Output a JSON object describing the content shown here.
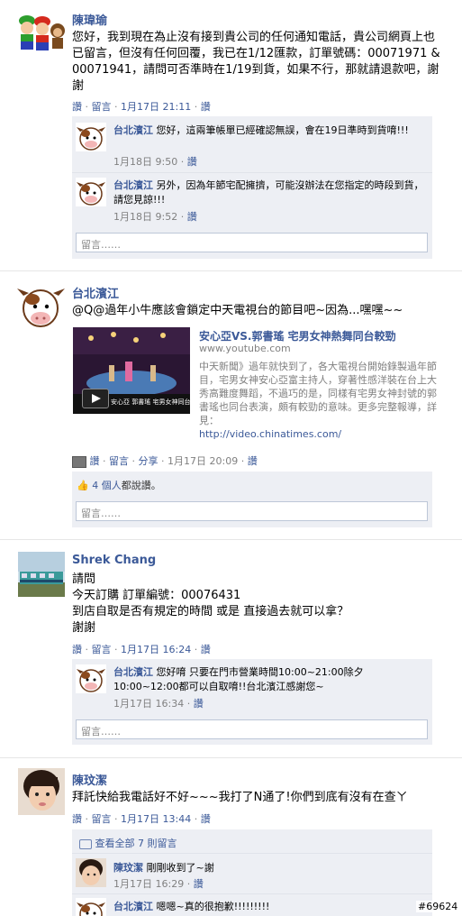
{
  "posts": [
    {
      "name": "陳瑋瑜",
      "text": "您好，我到現在為止沒有接到貴公司的任何通知電話，貴公司網頁上也已留言，但沒有任何回覆，我已在1/12匯款，訂單號碼：00071971 & 00071941，請問可否準時在1/19到貨，如果不行，那就請退款吧，謝謝",
      "like": "讚",
      "comment": "留言",
      "time": "1月17日 21:11",
      "replies": [
        {
          "name": "台北濱江",
          "text": "您好，這兩筆帳單已經確認無誤，會在19日準時到貨唷!!!",
          "time": "1月18日 9:50",
          "like": "讚"
        },
        {
          "name": "台北濱江",
          "text": "另外，因為年節宅配擁擠，可能沒辦法在您指定的時段到貨，請您見諒!!!",
          "time": "1月18日 9:52",
          "like": "讚"
        }
      ],
      "input_placeholder": "留言……"
    },
    {
      "name": "台北濱江",
      "text": "@Q@過年小牛應該會鎖定中天電視台的節目吧~因為...嘿嘿~~",
      "link_title": "安心亞VS.郭書瑤 宅男女神熱舞同台較勁",
      "link_domain": "www.youtube.com",
      "link_desc": "中天新聞》過年就快到了，各大電視台開始錄製過年節目，宅男女神安心亞富主持人，穿著性感洋裝在台上大秀高難度舞蹈，不過巧的是，同樣有宅男女神封號的郭書瑤也同台表演，頗有較勁的意味。更多完整報導，詳見：",
      "link_url": "http://video.chinatimes.com/",
      "thumb_caption": "安心亞 郭書瑤 宅男女神同台",
      "like": "讚",
      "comment": "留言",
      "share": "分享",
      "time": "1月17日 20:09",
      "likes_count": "4 個人",
      "likes_suffix": "都說讚。",
      "input_placeholder": "留言……"
    },
    {
      "name": "Shrek Chang",
      "lines": [
        "請問",
        "今天訂購 訂單編號：00076431",
        "到店自取是否有規定的時間 或是 直接過去就可以拿？",
        "謝謝"
      ],
      "like": "讚",
      "comment": "留言",
      "time": "1月17日 16:24",
      "replies": [
        {
          "name": "台北濱江",
          "text": "您好唷 只要在門市營業時間10:00~21:00除夕10:00~12:00都可以自取唷!!台北濱江感謝您~",
          "time": "1月17日 16:34",
          "like": "讚"
        }
      ],
      "input_placeholder": "留言……"
    },
    {
      "name": "陳玟潔",
      "text": "拜託快給我電話好不好~~~我打了N通了!你們到底有沒有在查ㄚ",
      "like": "讚",
      "comment": "留言",
      "time": "1月17日 13:44",
      "view_all": "查看全部 7 則留言",
      "replies": [
        {
          "name": "陳玟潔",
          "text": "剛剛收到了~謝",
          "time": "1月17日 16:29",
          "like": "讚"
        },
        {
          "name": "台北濱江",
          "text": "嗯嗯~真的很抱歉!!!!!!!!!",
          "time": "",
          "like": ""
        }
      ]
    }
  ],
  "watermark": "#69624",
  "colors": {
    "link": "#3b5998",
    "comment_bg": "#edeff4",
    "meta": "#808080"
  }
}
